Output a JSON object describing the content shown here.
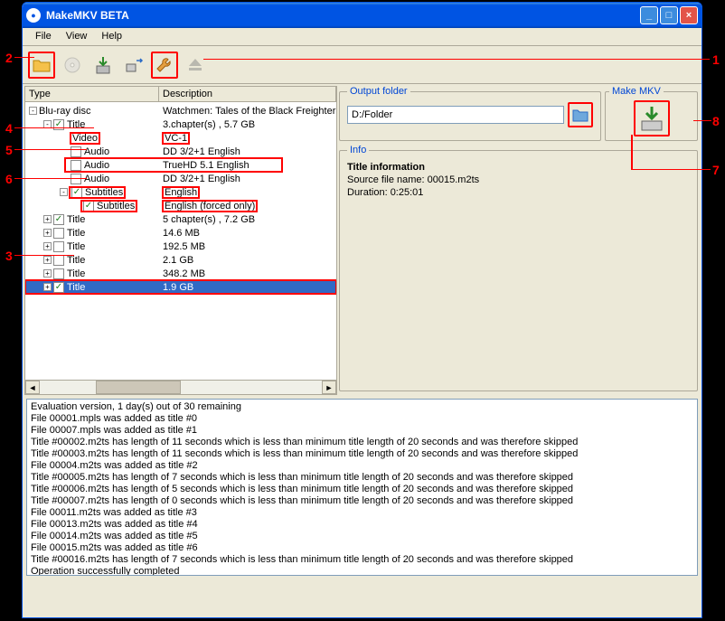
{
  "window": {
    "title": "MakeMKV BETA"
  },
  "menu": {
    "file": "File",
    "view": "View",
    "help": "Help"
  },
  "columns": {
    "type": "Type",
    "desc": "Description"
  },
  "tree": {
    "root": {
      "type": "Blu-ray disc",
      "desc": "Watchmen: Tales of the Black Freighter"
    },
    "t0": {
      "type": "Title",
      "desc": "3.chapter(s) , 5.7 GB"
    },
    "t0_video": {
      "type": "Video",
      "desc": "VC-1"
    },
    "t0_audio1": {
      "type": "Audio",
      "desc": "DD 3/2+1 English"
    },
    "t0_audio2": {
      "type": "Audio",
      "desc": "TrueHD 5.1 English"
    },
    "t0_audio3": {
      "type": "Audio",
      "desc": "DD 3/2+1 English"
    },
    "t0_sub1": {
      "type": "Subtitles",
      "desc": "English"
    },
    "t0_sub2": {
      "type": "Subtitles",
      "desc": "English  (forced only)"
    },
    "t1": {
      "type": "Title",
      "desc": "5 chapter(s) , 7.2 GB"
    },
    "t2": {
      "type": "Title",
      "desc": "14.6 MB"
    },
    "t3": {
      "type": "Title",
      "desc": "192.5 MB"
    },
    "t4": {
      "type": "Title",
      "desc": "2.1 GB"
    },
    "t5": {
      "type": "Title",
      "desc": "348.2 MB"
    },
    "t6": {
      "type": "Title",
      "desc": "1.9 GB"
    }
  },
  "output": {
    "legend": "Output folder",
    "path": "D:/Folder"
  },
  "make": {
    "legend": "Make MKV"
  },
  "info": {
    "legend": "Info",
    "title": "Title information",
    "l1": "Source file name: 00015.m2ts",
    "l2": "Duration: 0:25:01"
  },
  "log": [
    "Evaluation version, 1 day(s) out of 30 remaining",
    "File 00001.mpls was added as title #0",
    "File 00007.mpls was added as title #1",
    "Title #00002.m2ts has length of 11 seconds which is less than minimum title length of 20 seconds and was therefore skipped",
    "Title #00003.m2ts has length of 11 seconds which is less than minimum title length of 20 seconds and was therefore skipped",
    "File 00004.m2ts was added as title #2",
    "Title #00005.m2ts has length of 7 seconds which is less than minimum title length of 20 seconds and was therefore skipped",
    "Title #00006.m2ts has length of 5 seconds which is less than minimum title length of 20 seconds and was therefore skipped",
    "Title #00007.m2ts has length of 0 seconds which is less than minimum title length of 20 seconds and was therefore skipped",
    "File 00011.m2ts was added as title #3",
    "File 00013.m2ts was added as title #4",
    "File 00014.m2ts was added as title #5",
    "File 00015.m2ts was added as title #6",
    "Title #00016.m2ts has length of 7 seconds which is less than minimum title length of 20 seconds and was therefore skipped",
    "Operation successfully completed"
  ],
  "callouts": {
    "c1": "1",
    "c2": "2",
    "c3": "3",
    "c4": "4",
    "c5": "5",
    "c6": "6",
    "c7": "7",
    "c8": "8"
  }
}
